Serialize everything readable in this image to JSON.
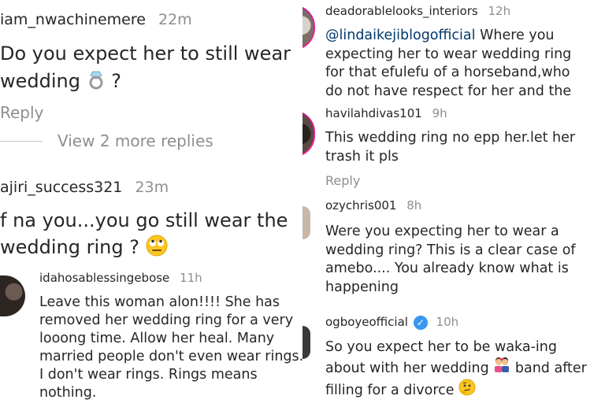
{
  "left": {
    "comments": [
      {
        "username": "iam_nwachinemere",
        "time": "22m",
        "text_line1": "Do you expect her to still wear",
        "text_line2": "wedding",
        "text_line2_suffix": "?",
        "reply": "Reply",
        "view_more": "View 2 more replies"
      },
      {
        "username": "ajiri_success321",
        "time": "23m",
        "text_line1": "f na you...you go still wear the",
        "text_line2": "wedding ring ?"
      },
      {
        "username": "idahosablessingebose",
        "time": "11h",
        "lines": [
          "Leave this woman alon!!!! She has",
          "removed her wedding ring for a very",
          "looong time. Allow her heal. Many",
          "married people don't even wear rings.",
          "I don't wear rings. Rings means",
          "nothing."
        ]
      }
    ]
  },
  "right": {
    "comments": [
      {
        "username": "deadorablelooks_interiors",
        "time": "12h",
        "mention": "@lindaikejiblogofficial",
        "first_line_rest": " Where you",
        "lines": [
          "expecting her to wear wedding ring",
          "for that efulefu of a horseband,who",
          "do not have respect for her and the"
        ]
      },
      {
        "username": "havilahdivas101",
        "time": "9h",
        "lines": [
          "This wedding ring no epp her.let her",
          "trash it pls"
        ],
        "reply": "Reply"
      },
      {
        "username": "ozychris001",
        "time": "8h",
        "lines": [
          "Were you expecting her to wear a",
          "wedding ring? This is a clear case of",
          "amebo.... You already know what is",
          "happening"
        ]
      },
      {
        "username": "ogboyeofficial",
        "time": "10h",
        "line1": "So you expect her to be waka-ing",
        "line2_a": "about with her wedding",
        "line2_b": " band after",
        "line3": "filling for a divorce"
      }
    ]
  },
  "colors": {
    "text": "#262626",
    "muted": "#8e8e8e",
    "link": "#00376b",
    "verified": "#3897f0",
    "story_ring": "#d62976"
  },
  "icons": [
    "ring-emoji-icon",
    "rolling-eyes-emoji-icon",
    "couple-emoji-icon",
    "thinking-emoji-icon",
    "verified-badge-icon"
  ]
}
